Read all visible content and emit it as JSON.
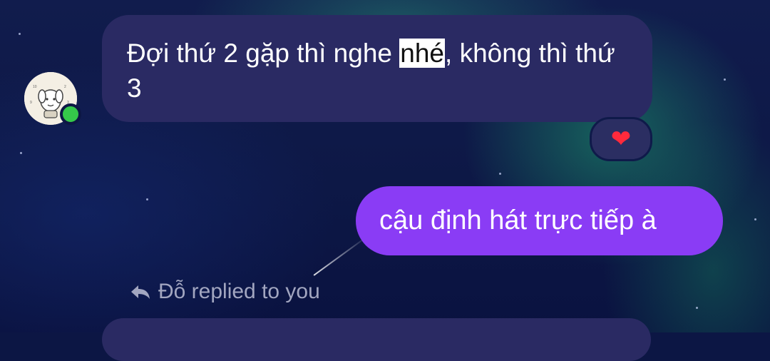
{
  "messages": [
    {
      "direction": "incoming",
      "text_before": "Đợi thứ 2 gặp thì nghe ",
      "text_highlighted": "nhé",
      "text_after": ", không thì thứ 3",
      "reaction": "❤"
    },
    {
      "direction": "outgoing",
      "text": "cậu định hát trực tiếp à"
    }
  ],
  "reply_note": {
    "text": "Đỗ replied to you",
    "icon": "reply-arrow-icon"
  },
  "avatar": {
    "online": true,
    "status_color": "#35c94a"
  },
  "colors": {
    "incoming_bubble": "#2a2a63",
    "outgoing_bubble": "#8a3cf5",
    "reaction_heart": "#ff2a3c"
  }
}
